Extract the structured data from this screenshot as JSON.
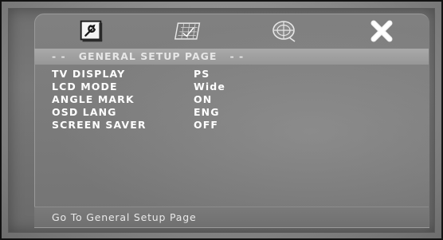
{
  "tabs": [
    {
      "name": "general-setup",
      "icon": "wrench-icon",
      "active": true
    },
    {
      "name": "video-setup",
      "icon": "chart-icon",
      "active": false
    },
    {
      "name": "audio-setup",
      "icon": "disc-icon",
      "active": false
    },
    {
      "name": "exit",
      "icon": "close-icon",
      "active": false
    }
  ],
  "header": {
    "title": "- -   GENERAL SETUP PAGE   - -"
  },
  "settings": [
    {
      "label": "TV DISPLAY",
      "value": "PS"
    },
    {
      "label": "LCD MODE",
      "value": "Wide"
    },
    {
      "label": "ANGLE MARK",
      "value": "ON"
    },
    {
      "label": "OSD LANG",
      "value": "ENG"
    },
    {
      "label": "SCREEN SAVER",
      "value": "OFF"
    }
  ],
  "status": {
    "text": "Go To General Setup Page"
  },
  "colors": {
    "text": "#ffffff",
    "header_bg": "#a0a0a0",
    "panel_bg": "#7c7c7c"
  }
}
